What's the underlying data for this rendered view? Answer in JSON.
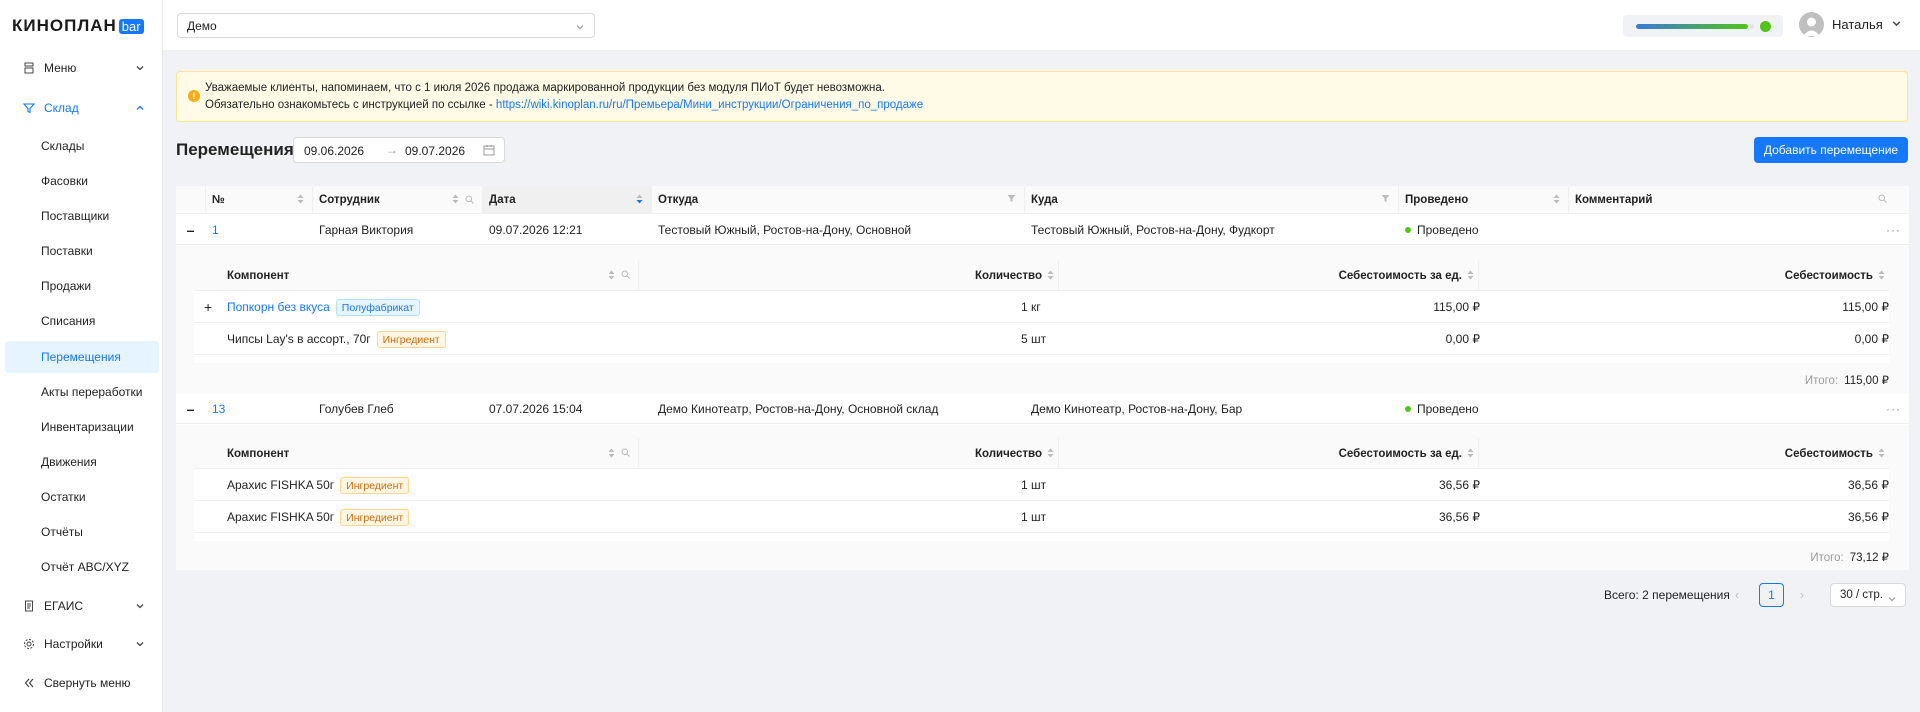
{
  "brand": {
    "name": "КИНОПЛАН",
    "badge": "bar"
  },
  "sidebar": {
    "menu": "Меню",
    "sklad": "Склад",
    "items": [
      "Склады",
      "Фасовки",
      "Поставщики",
      "Поставки",
      "Продажи",
      "Списания",
      "Перемещения",
      "Акты переработки",
      "Инвентаризации",
      "Движения",
      "Остатки",
      "Отчёты",
      "Отчёт ABC/XYZ"
    ],
    "selected": "Перемещения",
    "egais": "ЕГАИС",
    "settings": "Настройки",
    "collapse": "Свернуть меню"
  },
  "topbar": {
    "cinema_select": "Демо",
    "progress": 0.95,
    "user_name": "Наталья"
  },
  "banner": {
    "line1": "Уважаемые клиенты, напоминаем, что с 1 июля 2026 продажа маркированной продукции без модуля ПИоТ будет невозможна.",
    "line2_prefix": "Обязательно ознакомьтесь с инструкцией по ссылке - ",
    "link": "https://wiki.kinoplan.ru/ru/Премьера/Мини_инструкции/Ограничения_по_продаже"
  },
  "page": {
    "title": "Перемещения",
    "date_from": "09.06.2026",
    "date_to": "09.07.2026",
    "add_button": "Добавить перемещение"
  },
  "table": {
    "columns": {
      "num": "№",
      "employee": "Сотрудник",
      "date": "Дата",
      "from": "Откуда",
      "to": "Куда",
      "posted": "Проведено",
      "comment": "Комментарий"
    },
    "sub_columns": {
      "component": "Компонент",
      "qty": "Количество",
      "unit_cost": "Себестоимость за ед.",
      "cost": "Себестоимость"
    },
    "total_label": "Итого:",
    "rows": [
      {
        "num": "1",
        "employee": "Гарная Виктория",
        "date": "09.07.2026 12:21",
        "from": "Тестовый Южный, Ростов-на-Дону, Основной",
        "to": "Тестовый Южный, Ростов-на-Дону, Фудкорт",
        "status": "Проведено",
        "more": "···",
        "items": [
          {
            "name": "Попкорн без вкуса",
            "tag": "Полуфабрикат",
            "qty": "1 кг",
            "unit_cost": "115,00 ₽",
            "cost": "115,00 ₽"
          },
          {
            "name": "Чипсы Lay's в ассорт., 70г",
            "tag": "Ингредиент",
            "qty": "5 шт",
            "unit_cost": "0,00 ₽",
            "cost": "0,00 ₽"
          }
        ],
        "total": "115,00 ₽"
      },
      {
        "num": "13",
        "employee": "Голубев Глеб",
        "date": "07.07.2026 15:04",
        "from": "Демо Кинотеатр, Ростов-на-Дону, Основной склад",
        "to": "Демо Кинотеатр, Ростов-на-Дону, Бар",
        "status": "Проведено",
        "more": "···",
        "items": [
          {
            "name": "Арахис FISHKA 50г",
            "tag": "Ингредиент",
            "qty": "1 шт",
            "unit_cost": "36,56 ₽",
            "cost": "36,56 ₽"
          },
          {
            "name": "Арахис FISHKA 50г",
            "tag": "Ингредиент",
            "qty": "1 шт",
            "unit_cost": "36,56 ₽",
            "cost": "36,56 ₽"
          }
        ],
        "total": "73,12 ₽"
      }
    ]
  },
  "pagination": {
    "summary": "Всего: 2 перемещения",
    "current": "1",
    "page_size": "30 / стр."
  }
}
